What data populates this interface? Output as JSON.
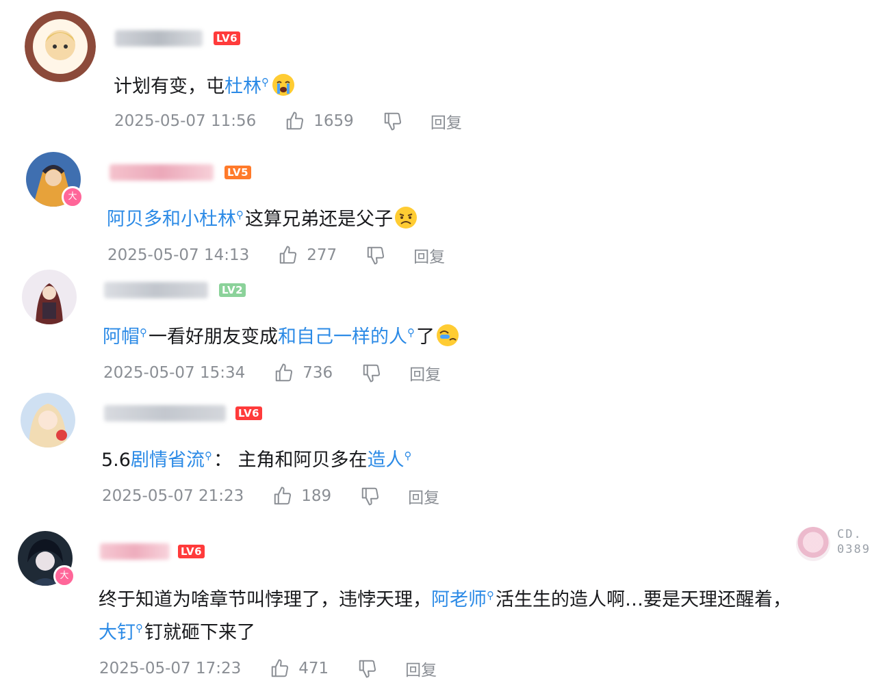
{
  "comments": [
    {
      "level": "LV6",
      "text": [
        {
          "t": "计划有变，屯"
        },
        {
          "t": "杜林",
          "link": true
        },
        {
          "t": "",
          "emoji": "crying-face"
        }
      ],
      "time": "2025-05-07 11:56",
      "likes": "1659",
      "reply": "回复"
    },
    {
      "level": "LV5",
      "text": [
        {
          "t": "阿贝多和小杜林",
          "link": true
        },
        {
          "t": "这算兄弟还是父子"
        },
        {
          "t": "",
          "emoji": "frowning-face"
        }
      ],
      "time": "2025-05-07 14:13",
      "likes": "277",
      "reply": "回复"
    },
    {
      "level": "LV2",
      "text": [
        {
          "t": "阿帽",
          "link": true
        },
        {
          "t": "一看好朋友变成"
        },
        {
          "t": "和自己一样的人",
          "link": true
        },
        {
          "t": "了"
        },
        {
          "t": "",
          "emoji": "awkward-face"
        }
      ],
      "time": "2025-05-07 15:34",
      "likes": "736",
      "reply": "回复"
    },
    {
      "level": "LV6",
      "text": [
        {
          "t": "5.6"
        },
        {
          "t": "剧情省流",
          "link": true
        },
        {
          "t": "： 主角和阿贝多在"
        },
        {
          "t": "造人",
          "link": true
        }
      ],
      "time": "2025-05-07 21:23",
      "likes": "189",
      "reply": "回复"
    },
    {
      "level": "LV6",
      "text_line1": [
        {
          "t": "终于知道为啥章节叫悖理了，违悖天理，"
        },
        {
          "t": "阿老师",
          "link": true
        },
        {
          "t": "活生生的造人啊…要是天理还醒着，"
        }
      ],
      "text_line2": [
        {
          "t": "大钉",
          "link": true
        },
        {
          "t": "钉就砸下来了"
        }
      ],
      "time": "2025-05-07 17:23",
      "likes": "471",
      "reply": "回复"
    }
  ],
  "badge_glyph": "大",
  "watermark": {
    "line1": "CD.",
    "line2": "0389"
  },
  "colors": {
    "link": "#2b8ae6",
    "meta": "#8a8e94",
    "lv6": "#ff3b3b",
    "lv5": "#ff7a2a",
    "lv2": "#8bd29a",
    "badge": "#ff6699"
  }
}
